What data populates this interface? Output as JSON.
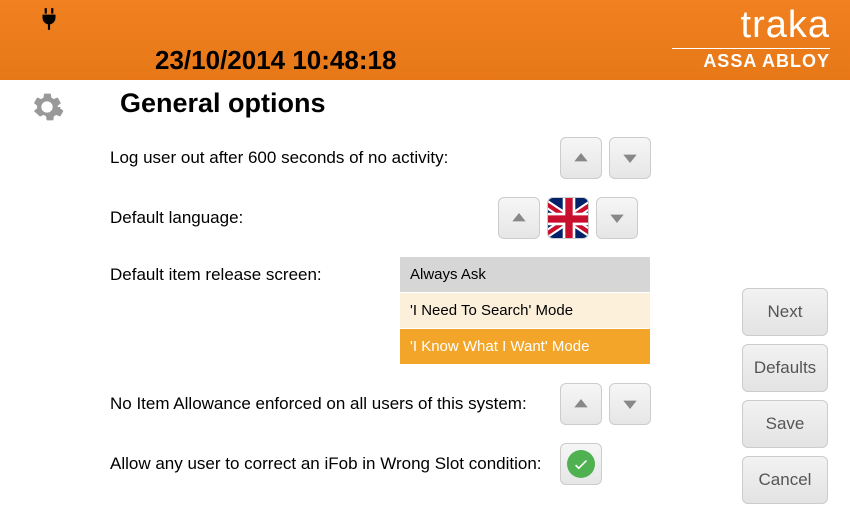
{
  "header": {
    "datetime": "23/10/2014 10:48:18",
    "brand_primary": "traka",
    "brand_secondary": "ASSA ABLOY"
  },
  "page": {
    "title": "General options"
  },
  "settings": {
    "logout": {
      "label": "Log user out after 600 seconds of no activity:"
    },
    "language": {
      "label": "Default language:",
      "value": "UK"
    },
    "release_screen": {
      "label": "Default item release screen:",
      "options": [
        "Always Ask",
        "'I Need To Search' Mode",
        "'I Know What I Want' Mode"
      ],
      "selected_index": 2
    },
    "item_allowance": {
      "label": "No Item Allowance enforced on all users of this system:"
    },
    "wrong_slot": {
      "label": "Allow any user to correct an iFob in Wrong Slot condition:",
      "value": true
    }
  },
  "side_buttons": {
    "next": "Next",
    "defaults": "Defaults",
    "save": "Save",
    "cancel": "Cancel"
  }
}
